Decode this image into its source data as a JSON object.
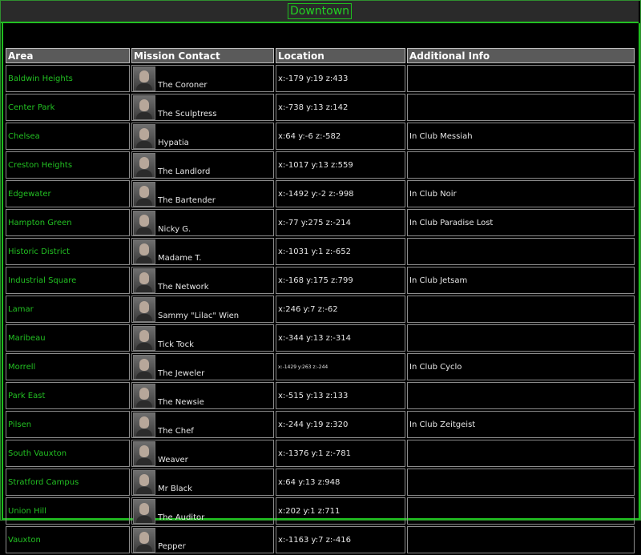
{
  "page_title": "Downtown",
  "columns": [
    "Area",
    "Mission Contact",
    "Location",
    "Additional Info"
  ],
  "rows": [
    {
      "area": "Baldwin Heights",
      "contact": "The Coroner",
      "location": "x:-179 y:19 z:433",
      "info": ""
    },
    {
      "area": "Center Park",
      "contact": "The Sculptress",
      "location": "x:-738 y:13 z:142",
      "info": ""
    },
    {
      "area": "Chelsea",
      "contact": "Hypatia",
      "location": "x:64 y:-6 z:-582",
      "info": "In Club Messiah"
    },
    {
      "area": "Creston Heights",
      "contact": "The Landlord",
      "location": "x:-1017 y:13 z:559",
      "info": ""
    },
    {
      "area": "Edgewater",
      "contact": "The Bartender",
      "location": "x:-1492 y:-2 z:-998",
      "info": "In Club Noir"
    },
    {
      "area": "Hampton Green",
      "contact": "Nicky G.",
      "location": "x:-77 y:275 z:-214",
      "info": "In Club Paradise Lost"
    },
    {
      "area": "Historic District",
      "contact": "Madame T.",
      "location": "x:-1031 y:1 z:-652",
      "info": ""
    },
    {
      "area": "Industrial Square",
      "contact": "The Network",
      "location": "x:-168 y:175 z:799",
      "info": "In Club Jetsam"
    },
    {
      "area": "Lamar",
      "contact": "Sammy \"Lilac\" Wien",
      "location": "x:246 y:7 z:-62",
      "info": ""
    },
    {
      "area": "Maribeau",
      "contact": "Tick Tock",
      "location": "x:-344 y:13 z:-314",
      "info": ""
    },
    {
      "area": "Morrell",
      "contact": "The Jeweler",
      "location": "x:-1429 y:263 z:-244",
      "info": "In Club Cyclo"
    },
    {
      "area": "Park East",
      "contact": "The Newsie",
      "location": "x:-515 y:13 z:133",
      "info": ""
    },
    {
      "area": "Pilsen",
      "contact": "The Chef",
      "location": "x:-244 y:19 z:320",
      "info": "In Club Zeitgeist"
    },
    {
      "area": "South Vauxton",
      "contact": "Weaver",
      "location": "x:-1376 y:1 z:-781",
      "info": ""
    },
    {
      "area": "Stratford Campus",
      "contact": "Mr Black",
      "location": "x:64 y:13 z:948",
      "info": ""
    },
    {
      "area": "Union Hill",
      "contact": "The Auditor",
      "location": "x:202 y:1 z:711",
      "info": ""
    },
    {
      "area": "Vauxton",
      "contact": "Pepper",
      "location": "x:-1163 y:7 z:-416",
      "info": ""
    }
  ]
}
